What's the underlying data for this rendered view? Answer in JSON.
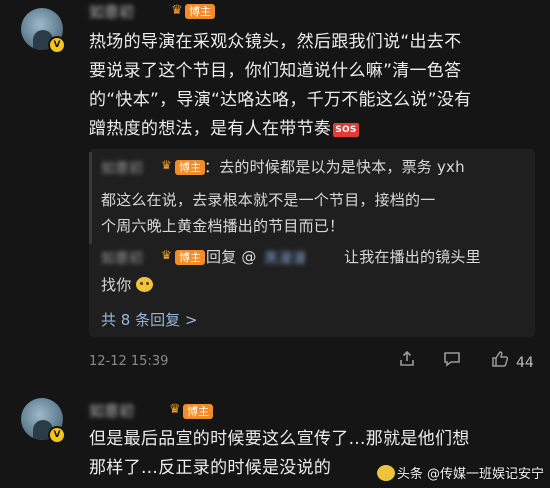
{
  "comment1": {
    "username": "如意初",
    "tag": "博主",
    "lines": [
      "热场的导演在采观众镜头，然后跟我们说“出去不",
      "要说录了这个节目，你们知道说什么嘛”清一色答",
      "的“快本”，导演“达咯达咯，千万不能这么说”没有",
      "蹭热度的想法，是有人在带节奏"
    ],
    "sos_label": "SOS",
    "time": "12-12 15:39",
    "likes": "44",
    "more_replies": "共 8 条回复 >"
  },
  "reply1": {
    "username": "如意初",
    "tag": "博主",
    "line1": "：去的时候都是以为是快本，票务 yxh",
    "line2": "都这么在说，去录根本就不是一个节目，接档的一",
    "line3": "个周六晚上黄金档播出的节目而已！"
  },
  "reply2": {
    "username": "如意初",
    "tag": "博主",
    "prefix": "回复 @",
    "mention": "黑漫漫",
    "line1": "让我在播出的镜头里",
    "line2": "找你"
  },
  "comment2": {
    "username": "如意初",
    "tag": "博主",
    "line1": "但是最后品宣的时候要这么宣传了…那就是他们想",
    "line2": "那样了…反正录的时候是没说的"
  },
  "watermark": "头条 @传媒一班娱记安宁",
  "icons": [
    "verified-badge-icon",
    "crown-icon",
    "share-icon",
    "comment-icon",
    "like-icon"
  ],
  "colors": {
    "accent_tag": "#f28c28",
    "link": "#9bb4d8",
    "verified": "#f5c518"
  }
}
